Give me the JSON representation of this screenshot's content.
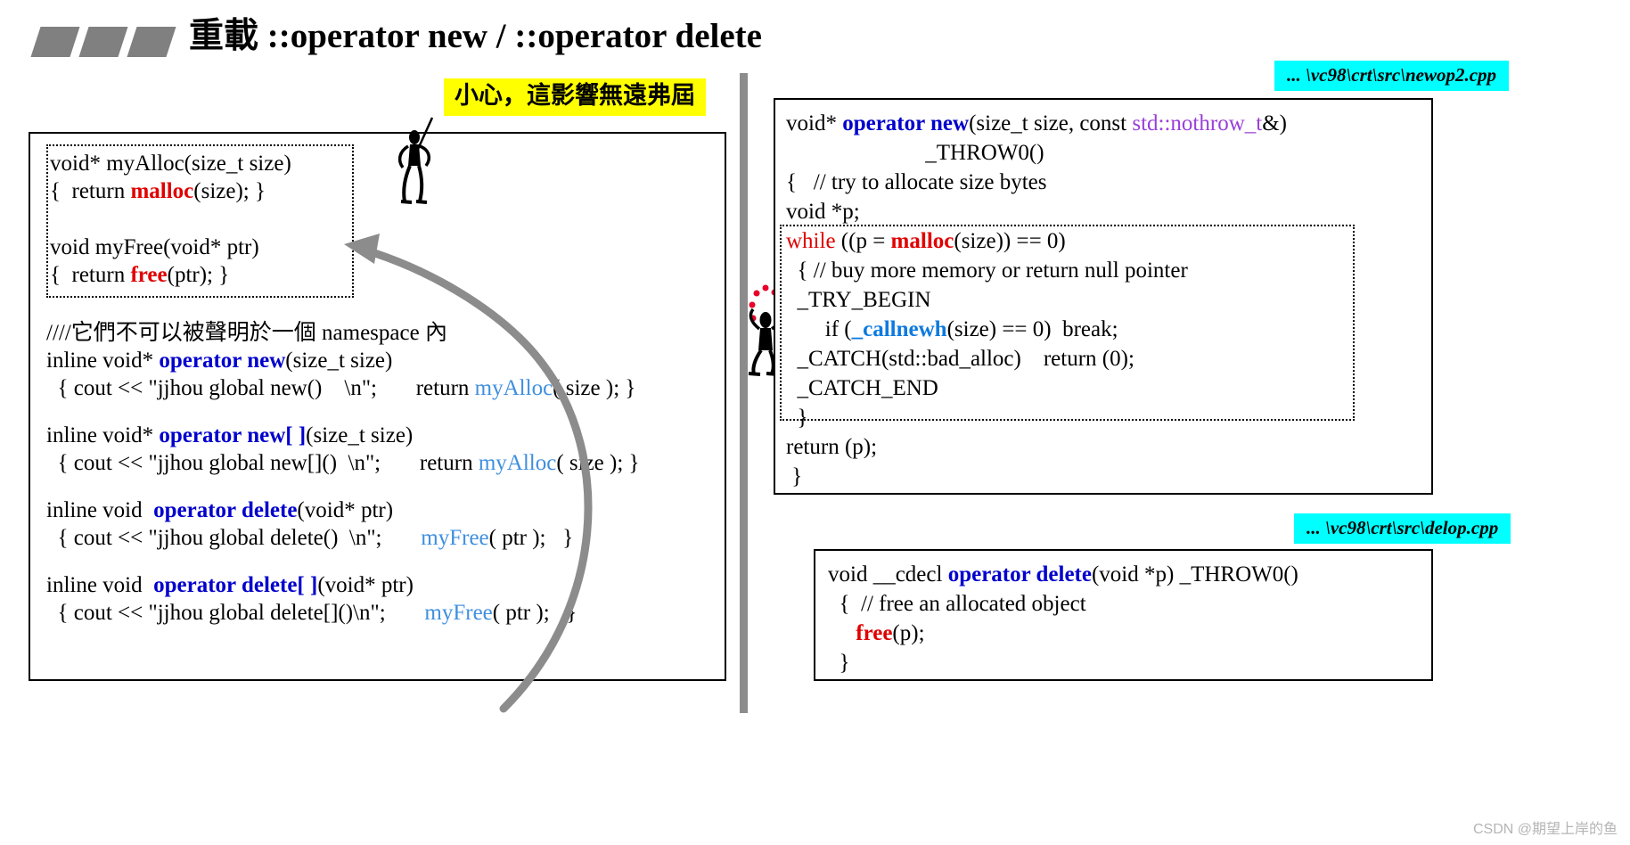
{
  "slide": {
    "title": "重載 ::operator new / ::operator delete",
    "bullets_icon": "three-parallelogram-bullets",
    "warning_note": "小心，這影響無遠弗屆",
    "watermark": "CSDN @期望上岸的鱼"
  },
  "left_panel": {
    "name": "left-code-panel",
    "helper_block": {
      "lines": [
        {
          "segments": [
            {
              "text": "void* myAlloc(size_t size)",
              "style": "plain"
            }
          ]
        },
        {
          "segments": [
            {
              "text": "{  return ",
              "style": "plain"
            },
            {
              "text": "malloc",
              "style": "kw-red"
            },
            {
              "text": "(size); }",
              "style": "plain"
            }
          ]
        }
      ]
    },
    "helper_block_2": {
      "lines": [
        {
          "segments": [
            {
              "text": "void myFree(void* ptr)",
              "style": "plain"
            }
          ]
        },
        {
          "segments": [
            {
              "text": "{  return ",
              "style": "plain"
            },
            {
              "text": "free",
              "style": "kw-red"
            },
            {
              "text": "(ptr); }",
              "style": "plain"
            }
          ]
        }
      ]
    },
    "main_block": {
      "lines": [
        {
          "segments": [
            {
              "text": "////它們不可以被聲明於一個 namespace 內",
              "style": "plain"
            }
          ]
        },
        {
          "segments": [
            {
              "text": "inline void* ",
              "style": "plain"
            },
            {
              "text": "operator new",
              "style": "kw-blue"
            },
            {
              "text": "(size_t size)",
              "style": "plain"
            }
          ]
        },
        {
          "segments": [
            {
              "text": "  { cout << \"jjhou global new()    \\n\";       return ",
              "style": "plain"
            },
            {
              "text": "myAlloc",
              "style": "kw-lblue"
            },
            {
              "text": "( size ); }",
              "style": "plain"
            }
          ]
        },
        {
          "segments": [
            {
              "text": "",
              "style": "blank"
            }
          ]
        },
        {
          "segments": [
            {
              "text": "inline void* ",
              "style": "plain"
            },
            {
              "text": "operator new[ ]",
              "style": "kw-blue"
            },
            {
              "text": "(size_t size)",
              "style": "plain"
            }
          ]
        },
        {
          "segments": [
            {
              "text": "  { cout << \"jjhou global new[]()  \\n\";       return ",
              "style": "plain"
            },
            {
              "text": "myAlloc",
              "style": "kw-lblue"
            },
            {
              "text": "( size ); }",
              "style": "plain"
            }
          ]
        },
        {
          "segments": [
            {
              "text": "",
              "style": "blank"
            }
          ]
        },
        {
          "segments": [
            {
              "text": "inline void  ",
              "style": "plain"
            },
            {
              "text": "operator delete",
              "style": "kw-blue"
            },
            {
              "text": "(void* ptr)",
              "style": "plain"
            }
          ]
        },
        {
          "segments": [
            {
              "text": "  { cout << \"jjhou global delete()  \\n\";       ",
              "style": "plain"
            },
            {
              "text": "myFree",
              "style": "kw-lblue"
            },
            {
              "text": "( ptr );   }",
              "style": "plain"
            }
          ]
        },
        {
          "segments": [
            {
              "text": "",
              "style": "blank"
            }
          ]
        },
        {
          "segments": [
            {
              "text": "inline void  ",
              "style": "plain"
            },
            {
              "text": "operator delete[ ]",
              "style": "kw-blue"
            },
            {
              "text": "(void* ptr)",
              "style": "plain"
            }
          ]
        },
        {
          "segments": [
            {
              "text": "  { cout << \"jjhou global delete[]()\\n\";       ",
              "style": "plain"
            },
            {
              "text": "myFree",
              "style": "kw-lblue"
            },
            {
              "text": "( ptr );   }",
              "style": "plain"
            }
          ]
        }
      ]
    }
  },
  "right_top": {
    "file_label": "... \\vc98\\crt\\src\\newop2.cpp",
    "lines": [
      {
        "segments": [
          {
            "text": "void* ",
            "style": "plain"
          },
          {
            "text": "operator new",
            "style": "kw-blue"
          },
          {
            "text": "(size_t size, const ",
            "style": "plain"
          },
          {
            "text": "std::nothrow_t",
            "style": "kw-purple"
          },
          {
            "text": "&)",
            "style": "plain"
          }
        ]
      },
      {
        "segments": [
          {
            "text": "                         _THROW0()",
            "style": "plain"
          }
        ]
      },
      {
        "segments": [
          {
            "text": "{   // try to allocate size bytes",
            "style": "plain"
          }
        ]
      },
      {
        "segments": [
          {
            "text": "void *p;",
            "style": "plain"
          }
        ]
      },
      {
        "segments": [
          {
            "text": "while",
            "style": "kw-red-plain"
          },
          {
            "text": " ((p = ",
            "style": "plain"
          },
          {
            "text": "malloc",
            "style": "kw-red"
          },
          {
            "text": "(size)) == 0)",
            "style": "plain"
          }
        ]
      },
      {
        "segments": [
          {
            "text": "  { // buy more memory or return null pointer",
            "style": "plain"
          }
        ]
      },
      {
        "segments": [
          {
            "text": "  _TRY_BEGIN",
            "style": "plain"
          }
        ]
      },
      {
        "segments": [
          {
            "text": "       if (",
            "style": "plain"
          },
          {
            "text": "_callnewh",
            "style": "kw-brightblue"
          },
          {
            "text": "(size) == 0)  break;",
            "style": "plain"
          }
        ]
      },
      {
        "segments": [
          {
            "text": "  _CATCH(std::bad_alloc)    return (0);",
            "style": "plain"
          }
        ]
      },
      {
        "segments": [
          {
            "text": "  _CATCH_END",
            "style": "plain"
          }
        ]
      },
      {
        "segments": [
          {
            "text": "  }",
            "style": "plain"
          }
        ]
      },
      {
        "segments": [
          {
            "text": "return (p);",
            "style": "plain"
          }
        ]
      },
      {
        "segments": [
          {
            "text": " }",
            "style": "plain"
          }
        ]
      }
    ]
  },
  "right_bottom": {
    "file_label": "... \\vc98\\crt\\src\\delop.cpp",
    "lines": [
      {
        "segments": [
          {
            "text": "void __cdecl ",
            "style": "plain"
          },
          {
            "text": "operator delete",
            "style": "kw-blue"
          },
          {
            "text": "(void *p) _THROW0()",
            "style": "plain"
          }
        ]
      },
      {
        "segments": [
          {
            "text": "  {  // free an allocated object",
            "style": "plain"
          }
        ]
      },
      {
        "segments": [
          {
            "text": "     ",
            "style": "plain"
          },
          {
            "text": "free",
            "style": "kw-red"
          },
          {
            "text": "(p);",
            "style": "plain"
          }
        ]
      },
      {
        "segments": [
          {
            "text": "  }",
            "style": "plain"
          }
        ]
      }
    ]
  },
  "decorations": {
    "arrow": "curved-arrow-pointing-to-helper-block",
    "figure_top": "stick-figure-with-flag",
    "figure_right": "stick-figure-with-red-dots"
  }
}
